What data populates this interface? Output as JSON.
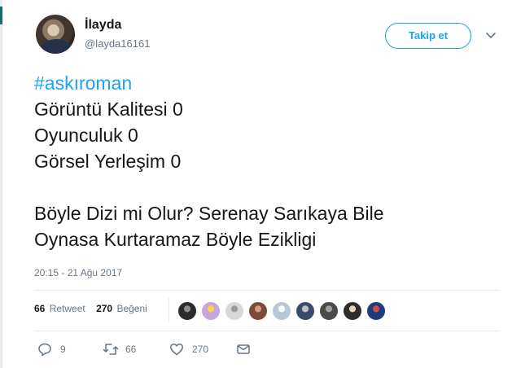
{
  "colors": {
    "accent": "#1da1f2",
    "text": "#14171a",
    "muted": "#657786",
    "divider": "#e6ecf0"
  },
  "user": {
    "name": "İlayda",
    "handle": "@layda16161",
    "avatar_icon": "user-avatar"
  },
  "header": {
    "follow_label": "Takip et",
    "menu_icon": "chevron-down-icon"
  },
  "tweet": {
    "hashtag": "#askıroman",
    "lines": [
      "Görüntü Kalitesi 0",
      "Oyunculuk 0",
      "Görsel Yerleşim 0",
      "",
      "Böyle Dizi mi Olur? Serenay Sarıkaya Bile",
      "Oynasa Kurtaramaz Böyle Ezikligi"
    ],
    "timestamp": "20:15 - 21 Ağu 2017"
  },
  "stats": {
    "retweet_count": "66",
    "retweet_label": "Retweet",
    "like_count": "270",
    "like_label": "Beğeni"
  },
  "likers": [
    {
      "color": "#2b2b2b",
      "accent": "#8a8a8a"
    },
    {
      "color": "#c7a6e0",
      "accent": "#ffd23f"
    },
    {
      "color": "#d8d8d8",
      "accent": "#9b9b9b"
    },
    {
      "color": "#7d4a3a",
      "accent": "#c9a080"
    },
    {
      "color": "#b8c7d6",
      "accent": "#ffffff"
    },
    {
      "color": "#3a4b6e",
      "accent": "#c0c0c0"
    },
    {
      "color": "#4a4a4a",
      "accent": "#a0a0a0"
    },
    {
      "color": "#2d2d2d",
      "accent": "#e8d3b8"
    },
    {
      "color": "#1f3c7a",
      "accent": "#d64545"
    }
  ],
  "actions": {
    "reply_count": "9",
    "retweet_count": "66",
    "like_count": "270"
  }
}
